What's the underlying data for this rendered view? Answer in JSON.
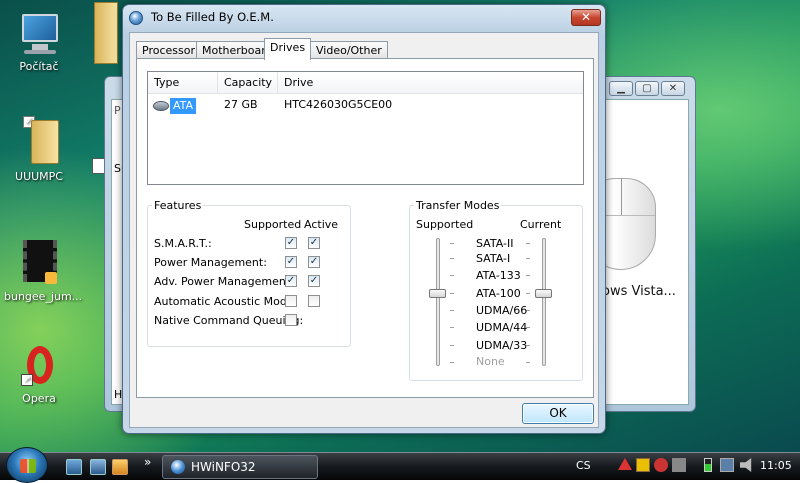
{
  "desktop": {
    "icons": [
      {
        "label": "Počítač",
        "icon": "computer-icon"
      },
      {
        "label": "UUUMPC",
        "icon": "folder-icon"
      },
      {
        "label": "bungee_jum...",
        "icon": "video-file-icon"
      },
      {
        "label": "Opera",
        "icon": "opera-icon"
      }
    ]
  },
  "background_window": {
    "partial_text": "ows Vista...",
    "left_letters": [
      "P",
      "Su",
      "H"
    ]
  },
  "dialog": {
    "title": "To Be Filled By O.E.M.",
    "close_label": "✕",
    "tabs": [
      {
        "label": "Processor"
      },
      {
        "label": "Motherboard"
      },
      {
        "label": "Drives"
      },
      {
        "label": "Video/Other"
      }
    ],
    "active_tab": "Drives",
    "drives_table": {
      "columns": [
        "Type",
        "Capacity",
        "Drive"
      ],
      "rows": [
        {
          "type": "ATA",
          "capacity": "27 GB",
          "drive": "HTC426030G5CE00"
        }
      ]
    },
    "features": {
      "title": "Features",
      "col_supported": "Supported",
      "col_active": "Active",
      "items": [
        {
          "label": "S.M.A.R.T.:",
          "supported": true,
          "active": true
        },
        {
          "label": "Power Management:",
          "supported": true,
          "active": true
        },
        {
          "label": "Adv. Power Management:",
          "supported": true,
          "active": true
        },
        {
          "label": "Automatic Acoustic Mode:",
          "supported": false,
          "active": false
        },
        {
          "label": "Native Command Queuing:",
          "supported": false,
          "active": null
        }
      ]
    },
    "transfer": {
      "title": "Transfer Modes",
      "col_supported": "Supported",
      "col_current": "Current",
      "modes": [
        "SATA-II",
        "SATA-I",
        "ATA-133",
        "ATA-100",
        "UDMA/66",
        "UDMA/44",
        "UDMA/33",
        "None"
      ],
      "supported_level": "ATA-100",
      "current_level": "ATA-100"
    },
    "ok_label": "OK"
  },
  "taskbar": {
    "task_label": "HWiNFO32",
    "language": "CS",
    "clock": "11:05",
    "overflow": "»"
  }
}
